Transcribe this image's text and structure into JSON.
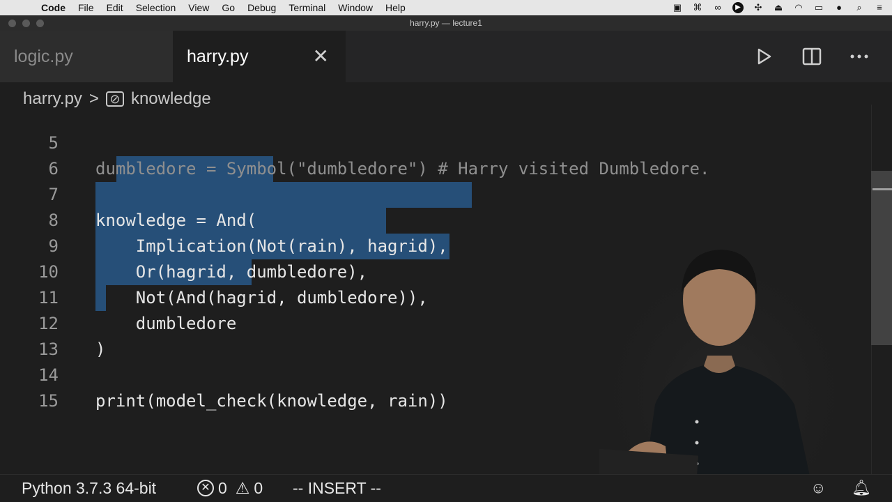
{
  "menubar": {
    "apple": "",
    "items": [
      "Code",
      "File",
      "Edit",
      "Selection",
      "View",
      "Go",
      "Debug",
      "Terminal",
      "Window",
      "Help"
    ],
    "status_icons": [
      "docker-icon",
      "command-icon",
      "glasses-icon",
      "play-circle-icon",
      "gesture-icon",
      "eject-icon",
      "wifi-icon",
      "battery-icon",
      "user-icon",
      "search-icon",
      "list-icon"
    ]
  },
  "window": {
    "title": "harry.py — lecture1"
  },
  "tabs": [
    {
      "label": "logic.py",
      "active": false
    },
    {
      "label": "harry.py",
      "active": true,
      "close": "✕"
    }
  ],
  "tab_actions": [
    "run-icon",
    "split-editor-icon",
    "more-icon"
  ],
  "breadcrumb": {
    "file": "harry.py",
    "separator": ">",
    "symbol": "knowledge"
  },
  "editor": {
    "lines": [
      {
        "num": "5",
        "text": "dumbledore = Symbol(\"dumbledore\") # Harry visited Dumbledore."
      },
      {
        "num": "6",
        "text": ""
      },
      {
        "num": "7",
        "text": "knowledge = And("
      },
      {
        "num": "8",
        "text": "    Implication(Not(rain), hagrid),"
      },
      {
        "num": "9",
        "text": "    Or(hagrid, dumbledore),"
      },
      {
        "num": "10",
        "text": "    Not(And(hagrid, dumbledore)),"
      },
      {
        "num": "11",
        "text": "    dumbledore"
      },
      {
        "num": "12",
        "text": ")"
      },
      {
        "num": "13",
        "text": ""
      },
      {
        "num": "14",
        "text": "print(model_check(knowledge, rain))"
      },
      {
        "num": "15",
        "text": ""
      }
    ]
  },
  "statusbar": {
    "interpreter": "Python 3.7.3 64-bit",
    "errors": "0",
    "warnings": "0",
    "mode": "-- INSERT --"
  },
  "colors": {
    "selection": "#264f78",
    "editor_bg": "#1e1e1e"
  }
}
